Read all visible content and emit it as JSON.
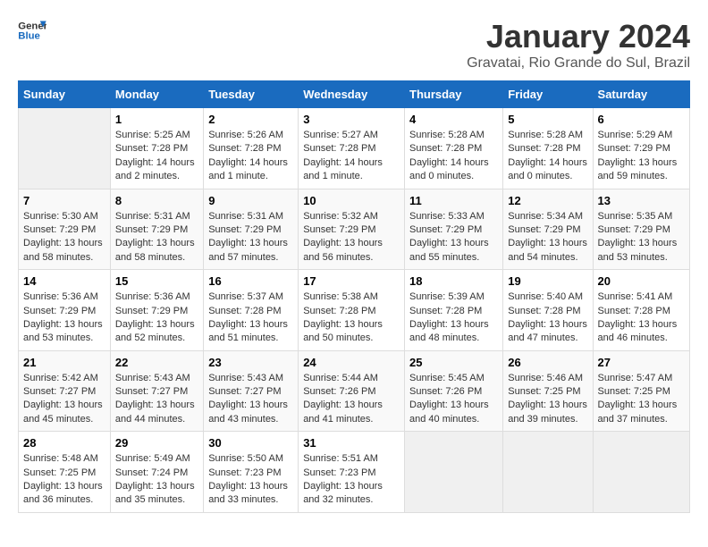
{
  "header": {
    "logo_text_general": "General",
    "logo_text_blue": "Blue",
    "title": "January 2024",
    "subtitle": "Gravatai, Rio Grande do Sul, Brazil"
  },
  "calendar": {
    "weekdays": [
      "Sunday",
      "Monday",
      "Tuesday",
      "Wednesday",
      "Thursday",
      "Friday",
      "Saturday"
    ],
    "weeks": [
      [
        {
          "day": "",
          "info": "",
          "empty": true
        },
        {
          "day": "1",
          "info": "Sunrise: 5:25 AM\nSunset: 7:28 PM\nDaylight: 14 hours and 2 minutes."
        },
        {
          "day": "2",
          "info": "Sunrise: 5:26 AM\nSunset: 7:28 PM\nDaylight: 14 hours and 1 minute."
        },
        {
          "day": "3",
          "info": "Sunrise: 5:27 AM\nSunset: 7:28 PM\nDaylight: 14 hours and 1 minute."
        },
        {
          "day": "4",
          "info": "Sunrise: 5:28 AM\nSunset: 7:28 PM\nDaylight: 14 hours and 0 minutes."
        },
        {
          "day": "5",
          "info": "Sunrise: 5:28 AM\nSunset: 7:28 PM\nDaylight: 14 hours and 0 minutes."
        },
        {
          "day": "6",
          "info": "Sunrise: 5:29 AM\nSunset: 7:29 PM\nDaylight: 13 hours and 59 minutes."
        }
      ],
      [
        {
          "day": "7",
          "info": "Sunrise: 5:30 AM\nSunset: 7:29 PM\nDaylight: 13 hours and 58 minutes."
        },
        {
          "day": "8",
          "info": "Sunrise: 5:31 AM\nSunset: 7:29 PM\nDaylight: 13 hours and 58 minutes."
        },
        {
          "day": "9",
          "info": "Sunrise: 5:31 AM\nSunset: 7:29 PM\nDaylight: 13 hours and 57 minutes."
        },
        {
          "day": "10",
          "info": "Sunrise: 5:32 AM\nSunset: 7:29 PM\nDaylight: 13 hours and 56 minutes."
        },
        {
          "day": "11",
          "info": "Sunrise: 5:33 AM\nSunset: 7:29 PM\nDaylight: 13 hours and 55 minutes."
        },
        {
          "day": "12",
          "info": "Sunrise: 5:34 AM\nSunset: 7:29 PM\nDaylight: 13 hours and 54 minutes."
        },
        {
          "day": "13",
          "info": "Sunrise: 5:35 AM\nSunset: 7:29 PM\nDaylight: 13 hours and 53 minutes."
        }
      ],
      [
        {
          "day": "14",
          "info": "Sunrise: 5:36 AM\nSunset: 7:29 PM\nDaylight: 13 hours and 53 minutes."
        },
        {
          "day": "15",
          "info": "Sunrise: 5:36 AM\nSunset: 7:29 PM\nDaylight: 13 hours and 52 minutes."
        },
        {
          "day": "16",
          "info": "Sunrise: 5:37 AM\nSunset: 7:28 PM\nDaylight: 13 hours and 51 minutes."
        },
        {
          "day": "17",
          "info": "Sunrise: 5:38 AM\nSunset: 7:28 PM\nDaylight: 13 hours and 50 minutes."
        },
        {
          "day": "18",
          "info": "Sunrise: 5:39 AM\nSunset: 7:28 PM\nDaylight: 13 hours and 48 minutes."
        },
        {
          "day": "19",
          "info": "Sunrise: 5:40 AM\nSunset: 7:28 PM\nDaylight: 13 hours and 47 minutes."
        },
        {
          "day": "20",
          "info": "Sunrise: 5:41 AM\nSunset: 7:28 PM\nDaylight: 13 hours and 46 minutes."
        }
      ],
      [
        {
          "day": "21",
          "info": "Sunrise: 5:42 AM\nSunset: 7:27 PM\nDaylight: 13 hours and 45 minutes."
        },
        {
          "day": "22",
          "info": "Sunrise: 5:43 AM\nSunset: 7:27 PM\nDaylight: 13 hours and 44 minutes."
        },
        {
          "day": "23",
          "info": "Sunrise: 5:43 AM\nSunset: 7:27 PM\nDaylight: 13 hours and 43 minutes."
        },
        {
          "day": "24",
          "info": "Sunrise: 5:44 AM\nSunset: 7:26 PM\nDaylight: 13 hours and 41 minutes."
        },
        {
          "day": "25",
          "info": "Sunrise: 5:45 AM\nSunset: 7:26 PM\nDaylight: 13 hours and 40 minutes."
        },
        {
          "day": "26",
          "info": "Sunrise: 5:46 AM\nSunset: 7:25 PM\nDaylight: 13 hours and 39 minutes."
        },
        {
          "day": "27",
          "info": "Sunrise: 5:47 AM\nSunset: 7:25 PM\nDaylight: 13 hours and 37 minutes."
        }
      ],
      [
        {
          "day": "28",
          "info": "Sunrise: 5:48 AM\nSunset: 7:25 PM\nDaylight: 13 hours and 36 minutes."
        },
        {
          "day": "29",
          "info": "Sunrise: 5:49 AM\nSunset: 7:24 PM\nDaylight: 13 hours and 35 minutes."
        },
        {
          "day": "30",
          "info": "Sunrise: 5:50 AM\nSunset: 7:23 PM\nDaylight: 13 hours and 33 minutes."
        },
        {
          "day": "31",
          "info": "Sunrise: 5:51 AM\nSunset: 7:23 PM\nDaylight: 13 hours and 32 minutes."
        },
        {
          "day": "",
          "info": "",
          "empty": true
        },
        {
          "day": "",
          "info": "",
          "empty": true
        },
        {
          "day": "",
          "info": "",
          "empty": true
        }
      ]
    ]
  }
}
